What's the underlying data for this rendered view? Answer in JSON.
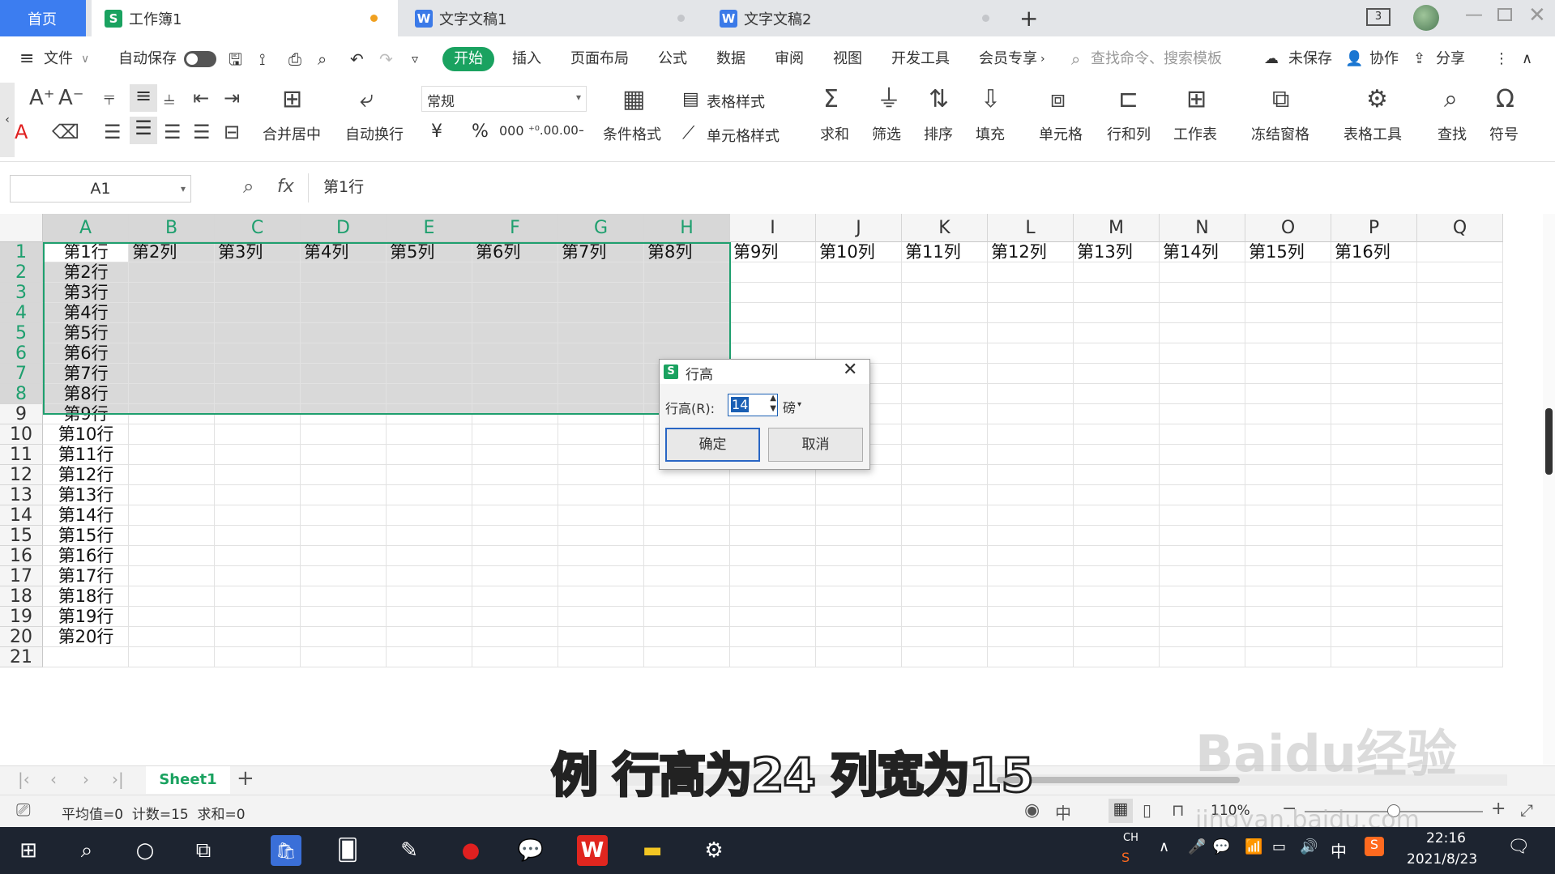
{
  "tabs": [
    {
      "label": "首页"
    },
    {
      "label": "工作簿1"
    },
    {
      "label": "文字文稿1"
    },
    {
      "label": "文字文稿2"
    }
  ],
  "titlebar": {
    "badge": "3"
  },
  "menu": {
    "file": "文件",
    "autosave": "自动保存",
    "items": [
      "开始",
      "插入",
      "页面布局",
      "公式",
      "数据",
      "审阅",
      "视图",
      "开发工具",
      "会员专享"
    ],
    "search_placeholder": "查找命令、搜索模板",
    "unsaved": "未保存",
    "collab": "协作",
    "share": "分享"
  },
  "ribbon": {
    "merge": "合并居中",
    "wrap": "自动换行",
    "format_value": "常规",
    "currency": "¥",
    "percent": "%",
    "thousands": "000",
    "dec_inc": "⁺⁰.00",
    "dec_dec": ".00→.0",
    "table_style": "表格样式",
    "cond_format": "条件格式",
    "cell_style": "单元格样式",
    "sum": "求和",
    "filter": "筛选",
    "sort": "排序",
    "fill": "填充",
    "cell": "单元格",
    "rowcol": "行和列",
    "sheet": "工作表",
    "freeze": "冻结窗格",
    "tools": "表格工具",
    "find": "查找",
    "symbol": "符号"
  },
  "formula_bar": {
    "cell_ref": "A1",
    "fx": "fx",
    "content": "第1行"
  },
  "columns": [
    "A",
    "B",
    "C",
    "D",
    "E",
    "F",
    "G",
    "H",
    "I",
    "J",
    "K",
    "L",
    "M",
    "N",
    "O",
    "P",
    "Q"
  ],
  "rows": [
    "1",
    "2",
    "3",
    "4",
    "5",
    "6",
    "7",
    "8",
    "9",
    "10",
    "11",
    "12",
    "13",
    "14",
    "15",
    "16",
    "17",
    "18",
    "19",
    "20",
    "21"
  ],
  "row1_cells": [
    "第1行",
    "第2列",
    "第3列",
    "第4列",
    "第5列",
    "第6列",
    "第7列",
    "第8列",
    "第9列",
    "第10列",
    "第11列",
    "第12列",
    "第13列",
    "第14列",
    "第15列",
    "第16列"
  ],
  "colA_cells": [
    "第2行",
    "第3行",
    "第4行",
    "第5行",
    "第6行",
    "第7行",
    "第8行",
    "第9行",
    "第10行",
    "第11行",
    "第12行",
    "第13行",
    "第14行",
    "第15行",
    "第16行",
    "第17行",
    "第18行",
    "第19行",
    "第20行"
  ],
  "dialog": {
    "title": "行高",
    "label": "行高(R):",
    "value": "14",
    "unit": "磅",
    "ok": "确定",
    "cancel": "取消"
  },
  "sheets": {
    "active": "Sheet1"
  },
  "status": {
    "stats": "平均值=0  计数=15  求和=0",
    "zoom": "110%"
  },
  "caption": "例 行高为24 列宽为15",
  "watermark": {
    "brand": "Baidu经验",
    "url": "jingyan.baidu.com"
  },
  "taskbar": {
    "lang": "CH",
    "ime": "中",
    "time": "22:16",
    "date": "2021/8/23"
  },
  "colors": {
    "accent_green": "#1aa260",
    "selection_border": "#1e9f6e",
    "selected_fill": "#d9d9d9",
    "taskbar": "#1d2430"
  }
}
